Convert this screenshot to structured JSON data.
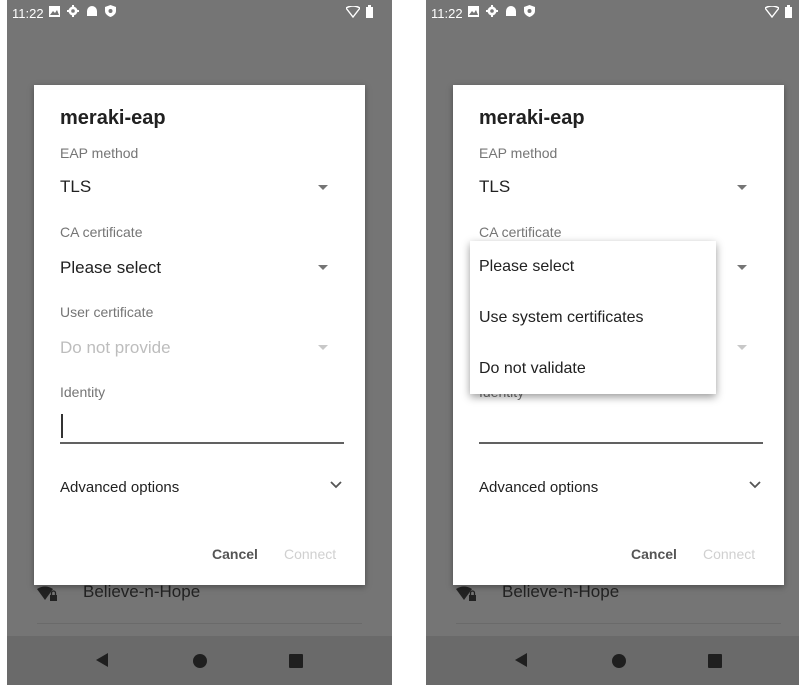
{
  "status_bar": {
    "time": "11:22",
    "icons": [
      "image-icon",
      "settings-gear-icon",
      "android-icon",
      "shield-icon"
    ],
    "right_icons": [
      "wifi-icon",
      "battery-icon"
    ]
  },
  "background_network": {
    "name": "Believe-n-Hope",
    "icon": "wifi-lock-icon"
  },
  "dialog": {
    "title": "meraki-eap",
    "eap_method": {
      "label": "EAP method",
      "value": "TLS"
    },
    "ca_certificate": {
      "label": "CA certificate",
      "value": "Please select"
    },
    "user_certificate": {
      "label": "User certificate",
      "value": "Do not provide",
      "disabled": true
    },
    "identity": {
      "label": "Identity",
      "value": ""
    },
    "advanced_options": {
      "label": "Advanced options"
    },
    "buttons": {
      "cancel": "Cancel",
      "connect": "Connect",
      "connect_enabled": false
    }
  },
  "ca_dropdown": {
    "open": true,
    "options": [
      "Please select",
      "Use system certificates",
      "Do not validate"
    ]
  },
  "nav_bar": {
    "icons": [
      "back-icon",
      "home-icon",
      "recents-icon"
    ]
  },
  "colors": {
    "scrim": "#757575",
    "dialog": "#ffffff",
    "text_primary": "#212121",
    "text_secondary": "#757575",
    "disabled": "#bdbdbd"
  }
}
